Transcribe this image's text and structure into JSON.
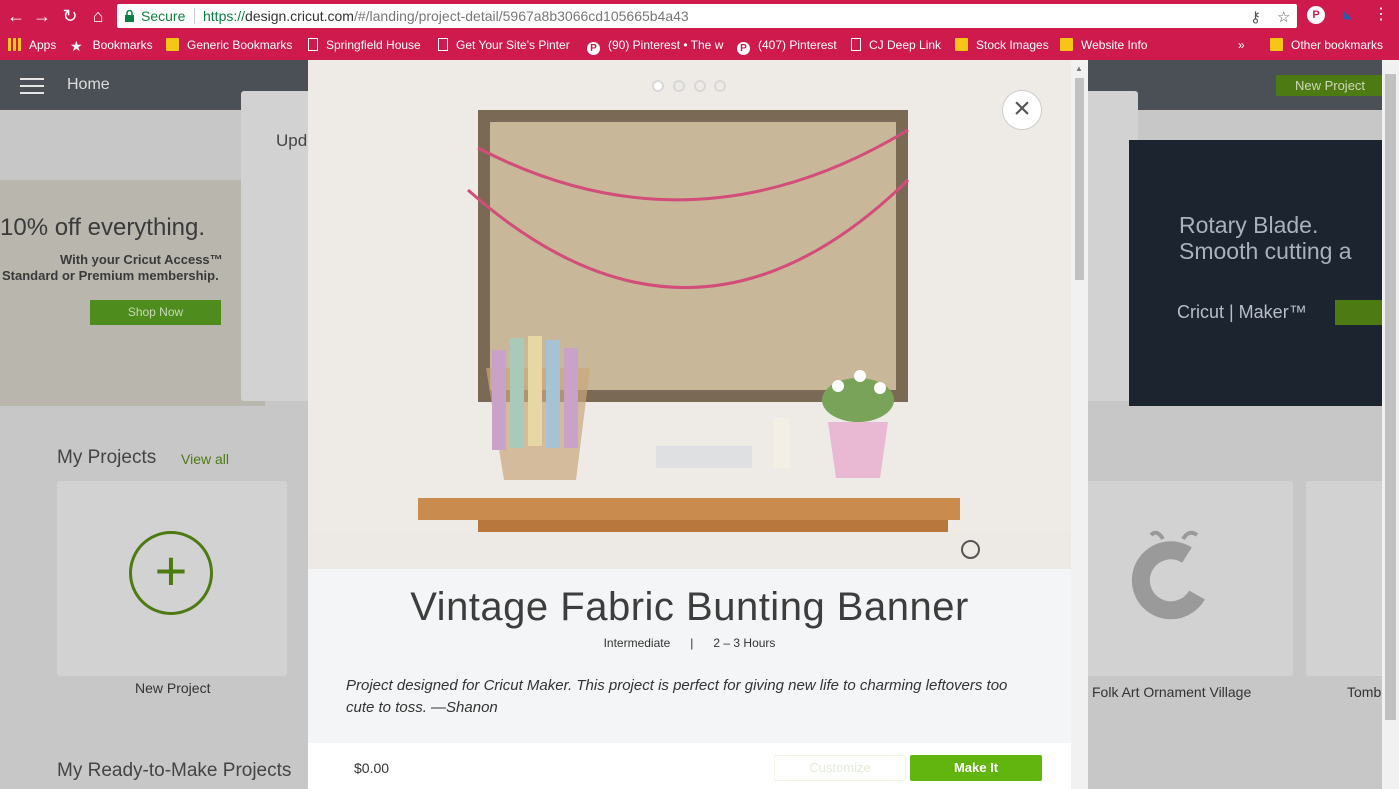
{
  "browser": {
    "secure_label": "Secure",
    "url_proto": "https://",
    "url_host": "design.cricut.com",
    "url_path": "/#/landing/project-detail/5967a8b3066cd105665b4a43",
    "bookmarks": [
      {
        "label": "Apps",
        "icon": "apps-icon"
      },
      {
        "label": "Bookmarks",
        "icon": "star-icon"
      },
      {
        "label": "Generic Bookmarks",
        "icon": "folder-icon"
      },
      {
        "label": "Springfield House",
        "icon": "page-icon"
      },
      {
        "label": "Get Your Site's Pinter",
        "icon": "page-icon"
      },
      {
        "label": "(90) Pinterest • The w",
        "icon": "pinterest-icon"
      },
      {
        "label": "(407) Pinterest",
        "icon": "pinterest-icon"
      },
      {
        "label": "CJ Deep Link",
        "icon": "page-icon"
      },
      {
        "label": "Stock Images",
        "icon": "folder-icon"
      },
      {
        "label": "Website Info",
        "icon": "folder-icon"
      }
    ],
    "overflow_label": "»",
    "other_bookmarks": "Other bookmarks"
  },
  "appbar": {
    "home": "Home",
    "new_project": "New Project"
  },
  "background": {
    "promo_title": "10% off everything.",
    "promo_sub1": "With your Cricut Access™",
    "promo_sub2": "Standard or Premium membership.",
    "shop_now": "Shop Now",
    "dialog_title": "Upd",
    "rotary_line1": "Rotary Blade.",
    "rotary_line2": "Smooth cutting a",
    "rotary_logo": "Cricut | Maker™",
    "my_projects": "My Projects",
    "view_all": "View all",
    "new_project": "New Project",
    "folk_art": "Folk Art Ornament Village",
    "tomb": "Tomb",
    "ready_to_make": "My Ready-to-Make Projects"
  },
  "modal": {
    "title": "Vintage Fabric Bunting Banner",
    "level": "Intermediate",
    "separator": "|",
    "duration": "2 – 3 Hours",
    "description": "Project designed for Cricut Maker. This project is perfect for giving new life to charming leftovers too cute to toss. —Shanon",
    "price": "$0.00",
    "customize": "Customize",
    "make_it": "Make It",
    "carousel_count": 4,
    "carousel_active": 1
  },
  "colors": {
    "chrome": "#cf1a4e",
    "accent": "#61b50e",
    "appbar": "#4a5055"
  }
}
